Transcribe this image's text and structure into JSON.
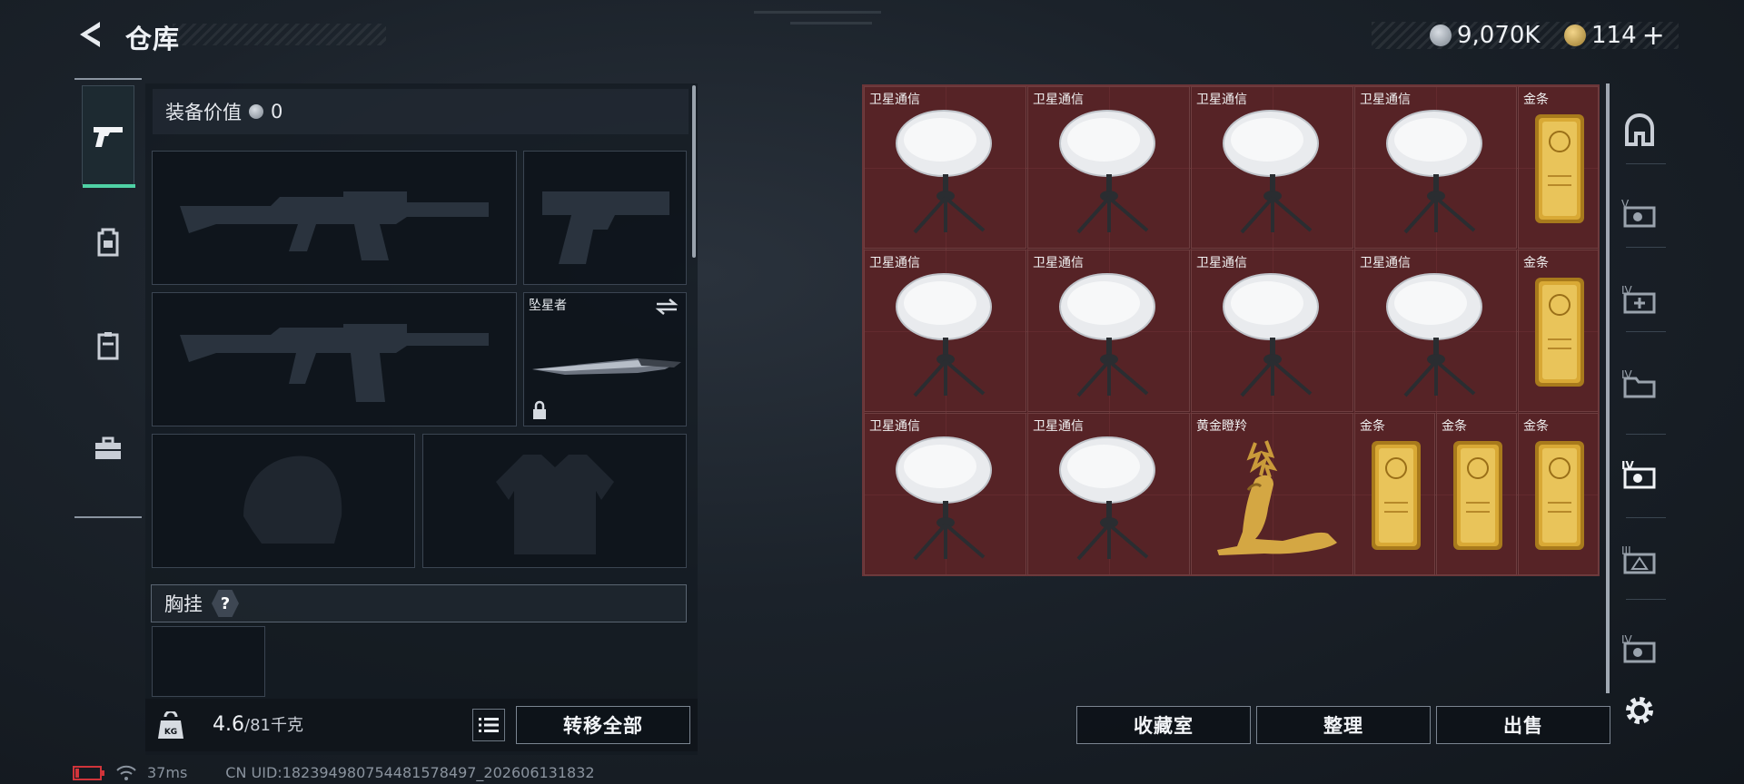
{
  "header": {
    "title": "仓库"
  },
  "currency": {
    "silver": "9,070K",
    "gold": "114",
    "plus": "+"
  },
  "left": {
    "equip_value_label": "装备价值",
    "equip_value": "0",
    "melee_name": "坠星者",
    "chest_label": "胸挂",
    "chest_help": "?",
    "weight_current": "4.6",
    "weight_max": "/81千克",
    "transfer_all": "转移全部"
  },
  "items": [
    {
      "label": "卫星通信",
      "icon": "satellite-dish"
    },
    {
      "label": "金条",
      "icon": "gold-bar"
    },
    {
      "label": "黄金瞪羚",
      "icon": "golden-gazelle"
    }
  ],
  "bottom_buttons": {
    "collection": "收藏室",
    "sort": "整理",
    "sell": "出售"
  },
  "status": {
    "ping": "37ms",
    "uid": "CN UID:182394980754481578497_202606131832"
  }
}
